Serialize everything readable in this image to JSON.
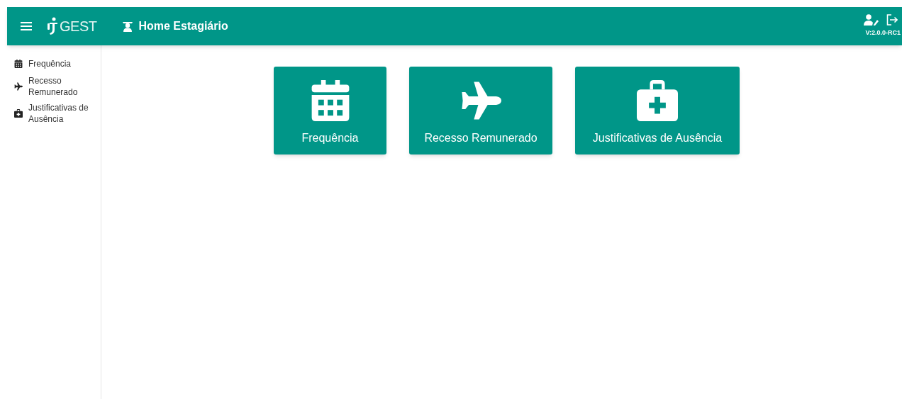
{
  "header": {
    "logo_text": "GEST",
    "title": "Home Estagiário",
    "version": "V:2.0.0-RC1"
  },
  "sidebar": {
    "items": [
      {
        "kind": "calendar",
        "label": "Frequência"
      },
      {
        "kind": "plane",
        "label": "Recesso Remunerado"
      },
      {
        "kind": "medkit",
        "label": "Justificativas de Ausência"
      }
    ]
  },
  "cards": [
    {
      "kind": "calendar",
      "label": "Frequência"
    },
    {
      "kind": "plane",
      "label": "Recesso Remunerado"
    },
    {
      "kind": "medkit",
      "label": "Justificativas de Ausência"
    }
  ]
}
